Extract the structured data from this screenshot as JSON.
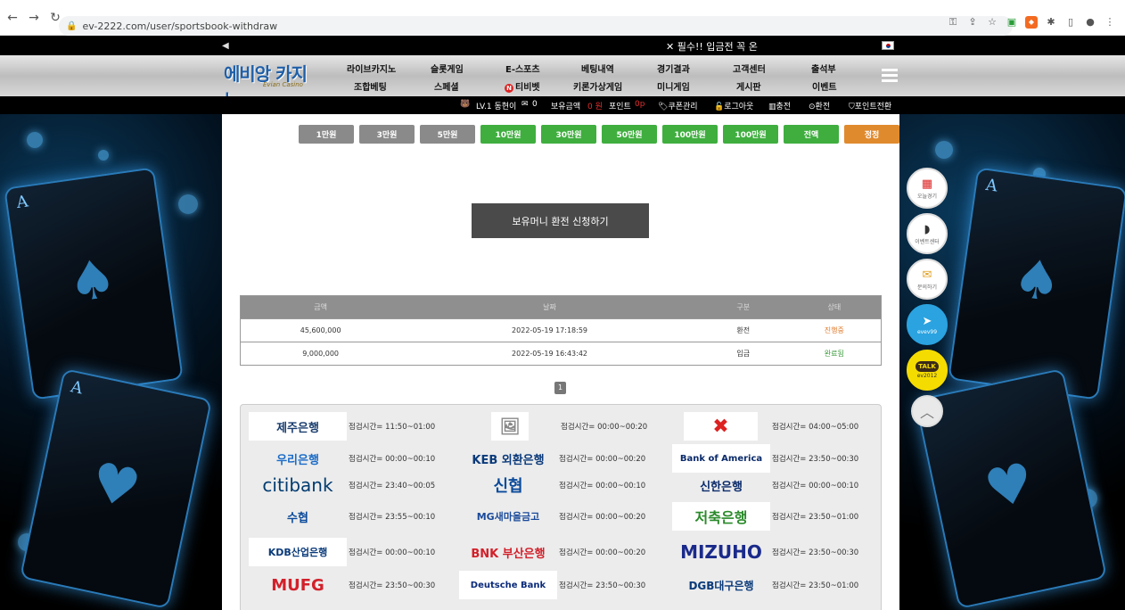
{
  "browser": {
    "url": "ev-2222.com/user/sportsbook-withdraw"
  },
  "notice": {
    "text": "✕ 필수!! 입금전 꼭 온"
  },
  "header": {
    "logo_main": "에비앙 카지노",
    "logo_sub": "Evian Casino",
    "menu_row1": [
      "라이브카지노",
      "슬롯게임",
      "E-스포츠",
      "베팅내역",
      "경기결과",
      "고객센터",
      "출석부"
    ],
    "menu_row2": [
      "조합베팅",
      "스페셜",
      "티비벳",
      "키론가상게임",
      "미니게임",
      "게시판",
      "이벤트"
    ],
    "badge_n": "N"
  },
  "userbar": {
    "level": "LV.1 동현이",
    "mail_count": "0",
    "balance_label": "보유금액",
    "balance_value": "0 원",
    "point_label": "포인트",
    "point_value": "0p",
    "coupon": "쿠폰관리",
    "logout": "로그아웃",
    "deposit": "충전",
    "withdraw": "환전",
    "point_convert": "포인트전환"
  },
  "amounts": {
    "buttons": [
      "1만원",
      "3만원",
      "5만원",
      "10만원",
      "30만원",
      "50만원",
      "100만원",
      "100만원",
      "전액",
      "정정"
    ]
  },
  "submit_label": "보유머니 환전 신청하기",
  "table": {
    "headers": [
      "금액",
      "날짜",
      "구분",
      "상태"
    ],
    "rows": [
      {
        "amount": "45,600,000",
        "date": "2022-05-19 17:18:59",
        "type": "환전",
        "status": "진행중"
      },
      {
        "amount": "9,000,000",
        "date": "2022-05-19 16:43:42",
        "type": "입금",
        "status": "완료됨"
      }
    ]
  },
  "pager": {
    "current": "1"
  },
  "banks": [
    {
      "name": "제주은행",
      "time": "점검시간= 11:50~01:00"
    },
    {
      "name": "",
      "time": "점검시간= 00:00~00:20"
    },
    {
      "name": "",
      "time": "점검시간= 04:00~05:00"
    },
    {
      "name": "우리은행",
      "time": "점검시간= 00:00~00:10"
    },
    {
      "name": "KEB 외환은행",
      "time": "점검시간= 00:00~00:20"
    },
    {
      "name": "Bank of America",
      "time": "점검시간= 23:50~00:30"
    },
    {
      "name": "citibank",
      "time": "점검시간= 23:40~00:05"
    },
    {
      "name": "신협",
      "time": "점검시간= 00:00~00:10"
    },
    {
      "name": "신한은행",
      "time": "점검시간= 00:00~00:10"
    },
    {
      "name": "수협",
      "time": "점검시간= 23:55~00:10"
    },
    {
      "name": "MG새마을금고",
      "time": "점검시간= 00:00~00:20"
    },
    {
      "name": "저축은행",
      "time": "점검시간= 23:50~01:00"
    },
    {
      "name": "KDB산업은행",
      "time": "점검시간= 00:00~00:10"
    },
    {
      "name": "BNK 부산은행",
      "time": "점검시간= 00:00~00:20"
    },
    {
      "name": "MIZUHO",
      "time": "점검시간= 23:50~00:30"
    },
    {
      "name": "MUFG",
      "time": "점검시간= 23:50~00:30"
    },
    {
      "name": "Deutsche Bank",
      "time": "점검시간= 23:50~00:30"
    },
    {
      "name": "DGB대구은행",
      "time": "점검시간= 23:50~01:00"
    }
  ],
  "float": {
    "live": "오늘경기",
    "event": "이벤트센터",
    "inquiry": "문의하기",
    "telegram": "evev99",
    "kakao_icon": "TALK",
    "kakao": "ev2012"
  },
  "icons": [
    "back-icon",
    "forward-icon",
    "reload-icon",
    "lock-icon",
    "key-icon",
    "share-icon",
    "star-icon",
    "extension-icon",
    "sidebar-icon",
    "profile-icon",
    "menu-icon",
    "speaker-icon",
    "korea-flag-icon",
    "hamburger-icon",
    "level-icon",
    "mail-icon",
    "coupon-icon",
    "logout-icon",
    "deposit-icon",
    "withdraw-icon",
    "shield-icon",
    "telegram-icon",
    "kakao-icon",
    "chevron-up-icon"
  ],
  "colors": {
    "green_button": "#3fae3f",
    "gray_button": "#8a8a8a",
    "orange_button": "#e08a2e",
    "status_pending": "#e07a2a",
    "status_done": "#3a9a3a",
    "logo_blue": "#1f5fa8"
  }
}
